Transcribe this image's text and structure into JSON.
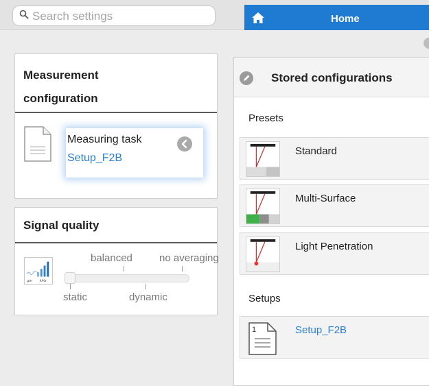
{
  "search": {
    "placeholder": "Search settings"
  },
  "home_tab": {
    "label": "Home"
  },
  "measurement": {
    "title": "Measurement configuration",
    "task_label": "Measuring task",
    "task_value": "Setup_F2B"
  },
  "signal_quality": {
    "title": "Signal quality",
    "labels_top": [
      "balanced",
      "no averaging"
    ],
    "labels_bottom": [
      "static",
      "dynamic"
    ],
    "icon_units": [
      "µm",
      "kHz"
    ]
  },
  "stored": {
    "title": "Stored configurations",
    "presets_label": "Presets",
    "presets": [
      {
        "name": "Standard"
      },
      {
        "name": "Multi-Surface"
      },
      {
        "name": "Light Penetration"
      }
    ],
    "setups_label": "Setups",
    "setups": [
      {
        "name": "Setup_F2B"
      }
    ]
  },
  "colors": {
    "accent": "#1f7ad1",
    "link": "#2a7fcf",
    "background": "#ececec"
  }
}
